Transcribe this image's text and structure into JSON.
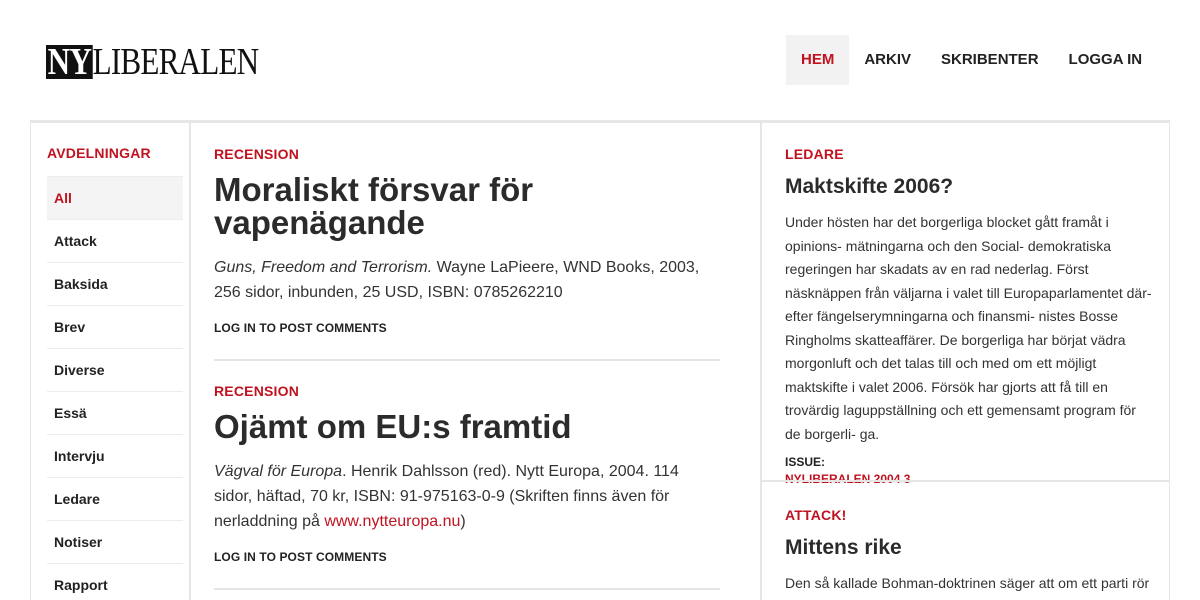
{
  "site": {
    "logo_ny": "NY",
    "logo_rest": "LIBERALEN"
  },
  "nav": {
    "items": [
      {
        "label": "HEM",
        "active": true
      },
      {
        "label": "ARKIV"
      },
      {
        "label": "SKRIBENTER"
      },
      {
        "label": "LOGGA IN"
      }
    ]
  },
  "sidebar": {
    "title": "AVDELNINGAR",
    "items": [
      {
        "label": "All",
        "active": true
      },
      {
        "label": "Attack"
      },
      {
        "label": "Baksida"
      },
      {
        "label": "Brev"
      },
      {
        "label": "Diverse"
      },
      {
        "label": "Essä"
      },
      {
        "label": "Intervju"
      },
      {
        "label": "Ledare"
      },
      {
        "label": "Notiser"
      },
      {
        "label": "Rapport"
      }
    ]
  },
  "main": {
    "articles": [
      {
        "kicker": "RECENSION",
        "title": "Moraliskt försvar för vapenägande",
        "book_title": "Guns, Freedom and Terrorism.",
        "details": " Wayne LaPieere, WND Books, 2003, 256 sidor, inbunden, 25 USD, ISBN: 0785262210",
        "action": "LOG IN TO POST COMMENTS"
      },
      {
        "kicker": "RECENSION",
        "title": "Ojämt om EU:s framtid",
        "book_title": "Vägval för Europa",
        "details": ". Henrik Dahlsson (red). Nytt Europa, 2004. 114 sidor, häftad, 70 kr, ISBN: 91-975163-0-9 (Skriften finns även för nerladdning på ",
        "link": "www.nytteuropa.nu",
        "details_end": ")",
        "action": "LOG IN TO POST COMMENTS"
      }
    ]
  },
  "right": {
    "blocks": [
      {
        "kicker": "LEDARE",
        "title": "Maktskifte 2006?",
        "text": "Under hösten har det borgerliga blocket gått framåt i opinions- mätningarna och den Social- demokratiska regeringen har skadats av en rad nederlag. Först näsknäppen från väljarna i valet till Europaparlamentet där- efter fängelserymningarna och finansmi- nistes Bosse Ringholms skatteaffärer. De borgerliga har börjat vädra morgonluft och det talas till och med om ett möjligt maktskifte i valet 2006. Försök har gjorts att få till en trovärdig laguppställning och ett gemensamt program för de borgerli- ga.",
        "meta_label": "ISSUE:",
        "meta_value": "NYLIBERALEN 2004 3"
      },
      {
        "kicker": "ATTACK!",
        "title": "Mittens rike",
        "text": "Den så kallade Bohman-doktrinen säger att om ett parti rör sig mot en av ytterkanterna följer mittenpositionen med."
      }
    ]
  }
}
